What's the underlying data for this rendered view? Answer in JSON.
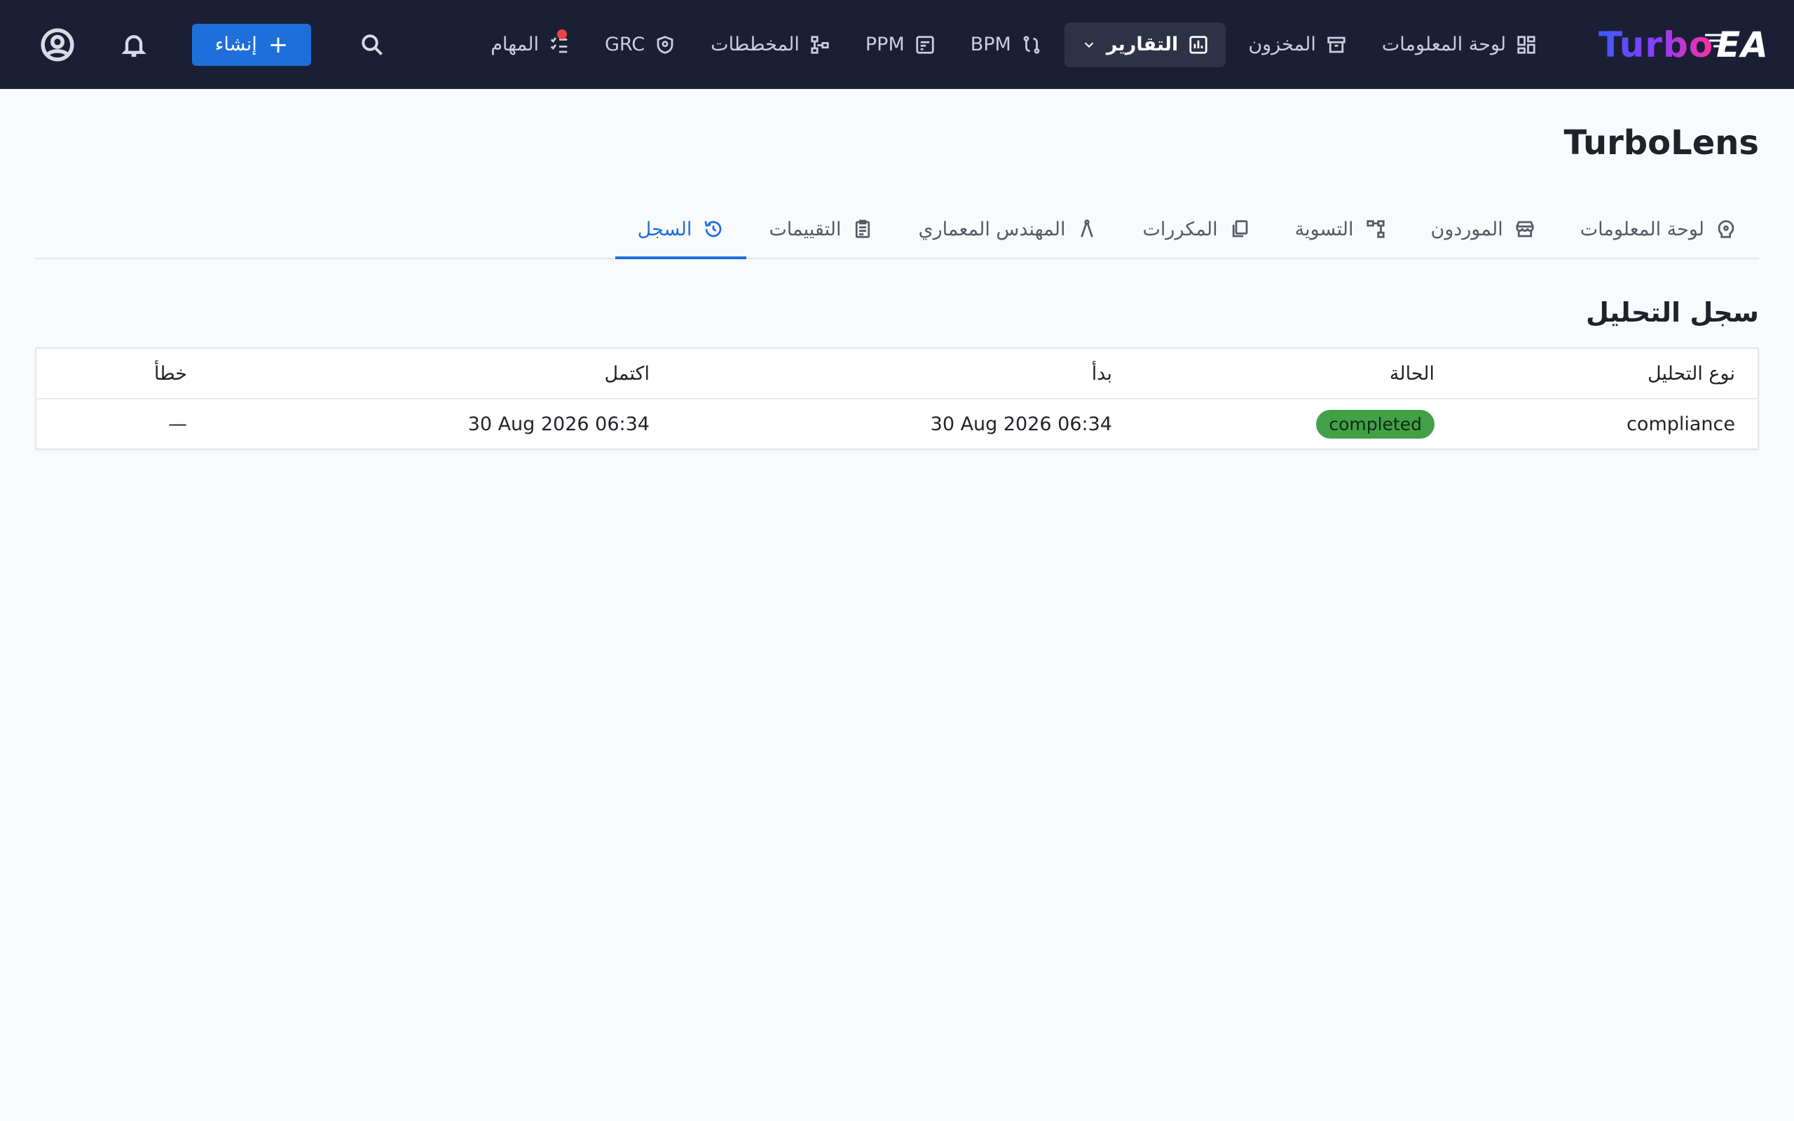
{
  "app": {
    "logo_turbo": "Turbo",
    "logo_ea": "EA"
  },
  "nav": {
    "items": [
      {
        "label": "لوحة المعلومات",
        "icon": "dashboard-grid-icon"
      },
      {
        "label": "المخزون",
        "icon": "archive-box-icon"
      },
      {
        "label": "التقارير",
        "icon": "bar-chart-icon",
        "active": true,
        "dropdown": true
      },
      {
        "label": "BPM",
        "icon": "process-flow-icon"
      },
      {
        "label": "PPM",
        "icon": "project-board-icon"
      },
      {
        "label": "المخططات",
        "icon": "diagram-icon"
      },
      {
        "label": "GRC",
        "icon": "shield-icon"
      },
      {
        "label": "المهام",
        "icon": "checklist-icon",
        "notification_dot": true
      }
    ],
    "create_label": "إنشاء",
    "icons": [
      "search-icon",
      "bell-icon",
      "account-circle-icon",
      "plus-icon",
      "chevron-down-icon"
    ]
  },
  "page": {
    "title": "TurboLens"
  },
  "tabs": [
    {
      "label": "لوحة المعلومات",
      "icon": "insights-icon"
    },
    {
      "label": "الموردون",
      "icon": "storefront-icon"
    },
    {
      "label": "التسوية",
      "icon": "hierarchy-icon"
    },
    {
      "label": "المكررات",
      "icon": "copy-icon"
    },
    {
      "label": "المهندس المعماري",
      "icon": "compass-icon"
    },
    {
      "label": "التقييمات",
      "icon": "clipboard-icon"
    },
    {
      "label": "السجل",
      "icon": "history-icon",
      "active": true
    }
  ],
  "log": {
    "title": "سجل التحليل",
    "columns": {
      "type": "نوع التحليل",
      "status": "الحالة",
      "started": "بدأ",
      "completed": "اكتمل",
      "error": "خطأ"
    },
    "rows": [
      {
        "type": "compliance",
        "status": "completed",
        "started": "30 Aug 2026 06:34",
        "completed": "30 Aug 2026 06:34",
        "error": "—"
      }
    ]
  },
  "colors": {
    "topbar": "#1b1f36",
    "accent": "#1e6fd9",
    "status_completed": "#43a047",
    "notification": "#ef4444"
  }
}
